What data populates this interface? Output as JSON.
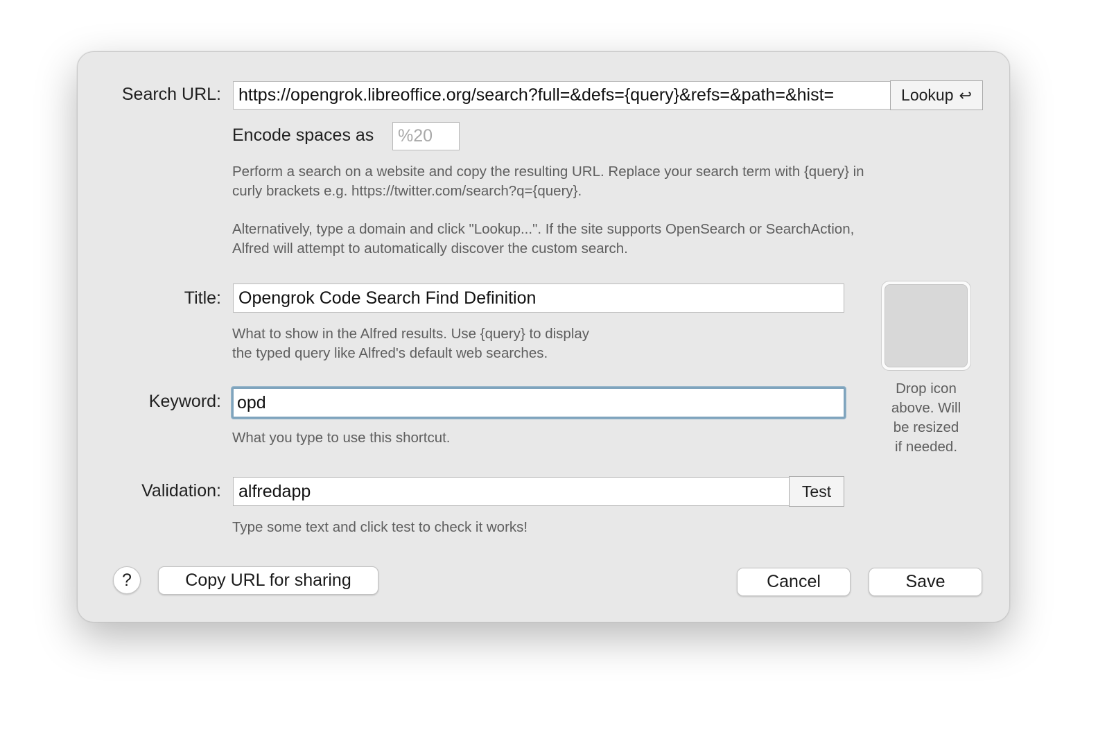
{
  "search_url": {
    "label": "Search URL:",
    "value": "https://opengrok.libreoffice.org/search?full=&defs={query}&refs=&path=&hist=",
    "lookup_label": "Lookup",
    "lookup_icon": "return-arrow-icon",
    "lookup_glyph": "↩"
  },
  "encode": {
    "label": "Encode spaces as",
    "placeholder": "%20"
  },
  "help_text": {
    "line1": "Perform a search on a website and copy the resulting URL. Replace your search term with {query} in",
    "line2": "curly brackets e.g. https://twitter.com/search?q={query}.",
    "line3": "Alternatively, type a domain and click \"Lookup...\". If the site supports OpenSearch or SearchAction,",
    "line4": "Alfred will attempt to automatically discover the custom search."
  },
  "title": {
    "label": "Title:",
    "value": "Opengrok Code Search Find Definition",
    "help_line1": "What to show in the Alfred results. Use {query} to display",
    "help_line2": "the typed query like Alfred's default web searches."
  },
  "keyword": {
    "label": "Keyword:",
    "value": "opd",
    "help": "What you type to use this shortcut."
  },
  "validation": {
    "label": "Validation:",
    "value": "alfredapp",
    "test_label": "Test",
    "help": "Type some text and click test to check it works!"
  },
  "icon_drop": {
    "line1": "Drop icon",
    "line2": "above. Will",
    "line3": "be resized",
    "line4": "if needed."
  },
  "footer": {
    "help_glyph": "?",
    "copy_url_label": "Copy URL for sharing",
    "cancel_label": "Cancel",
    "save_label": "Save"
  },
  "colors": {
    "dialog_bg": "#e8e8e8",
    "focus_ring": "#7fa4bd",
    "help_text": "#5e5e5e"
  }
}
